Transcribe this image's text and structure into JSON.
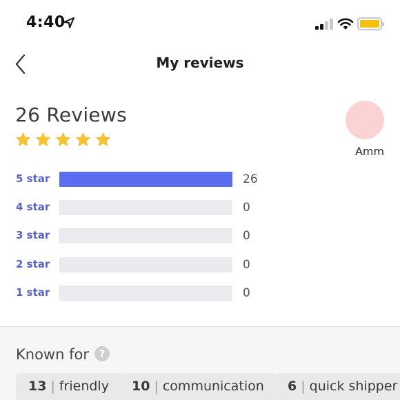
{
  "status_bar": {
    "time": "4:40",
    "icons": [
      "location-arrow-icon",
      "cellular-signal-icon",
      "wifi-icon",
      "battery-icon"
    ],
    "battery_color": "#f4c10d"
  },
  "nav": {
    "title": "My reviews",
    "back_icon": "chevron-left-icon"
  },
  "summary": {
    "reviews_count": "26 Reviews",
    "star_rating": 5,
    "star_color": "#f5c232"
  },
  "profile": {
    "name": "Amm",
    "avatar_color": "#fbd3d3"
  },
  "histogram": {
    "bar_color": "#5c6ef0",
    "track_color": "#ebebef",
    "label_color": "#5a63c8",
    "rows": [
      {
        "label": "5 star",
        "count": "26",
        "fraction": 1.0
      },
      {
        "label": "4 star",
        "count": "0",
        "fraction": 0
      },
      {
        "label": "3 star",
        "count": "0",
        "fraction": 0
      },
      {
        "label": "2 star",
        "count": "0",
        "fraction": 0
      },
      {
        "label": "1 star",
        "count": "0",
        "fraction": 0
      }
    ]
  },
  "known_for": {
    "title": "Known for",
    "help_icon": "question-mark-icon",
    "help_glyph": "?",
    "separator": "|",
    "tags": [
      {
        "count": "13",
        "label": "friendly"
      },
      {
        "count": "10",
        "label": "communication"
      },
      {
        "count": "6",
        "label": "quick shipper"
      }
    ]
  }
}
